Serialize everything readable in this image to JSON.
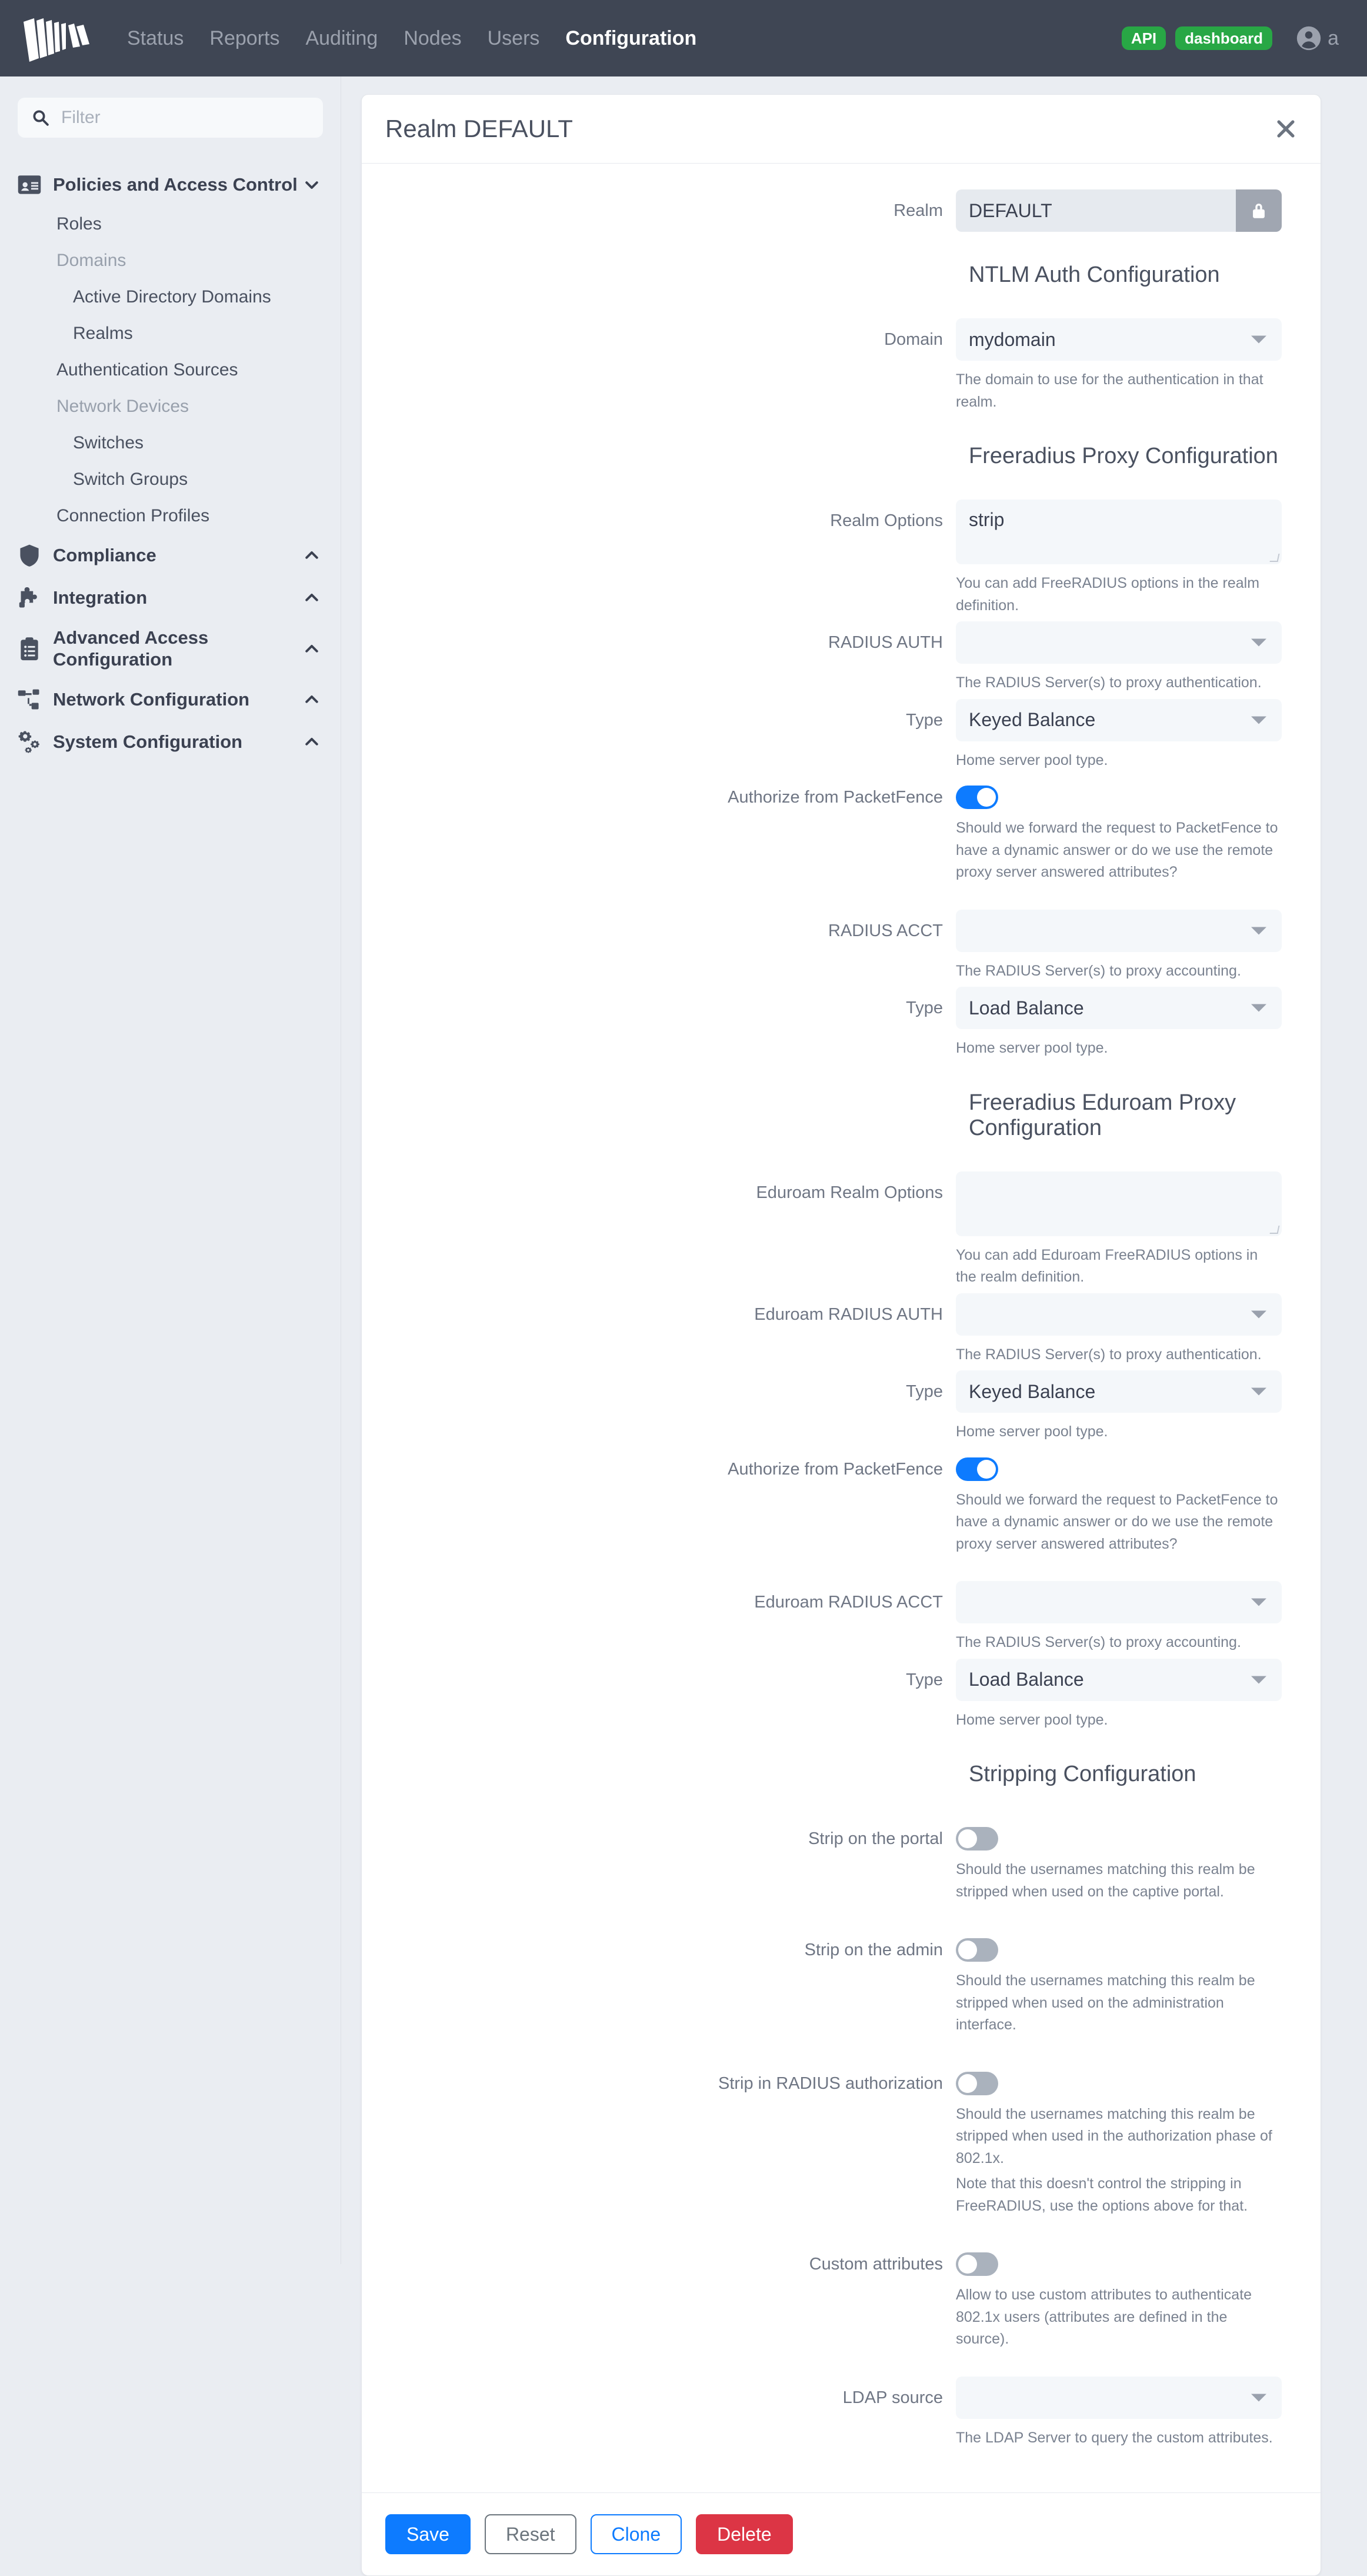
{
  "navbar": {
    "logo_name": "packetfence-logo",
    "links": [
      {
        "label": "Status",
        "active": false
      },
      {
        "label": "Reports",
        "active": false
      },
      {
        "label": "Auditing",
        "active": false
      },
      {
        "label": "Nodes",
        "active": false
      },
      {
        "label": "Users",
        "active": false
      },
      {
        "label": "Configuration",
        "active": true
      }
    ],
    "badges": [
      {
        "label": "API",
        "color": "#28a745"
      },
      {
        "label": "dashboard",
        "color": "#28a745"
      }
    ],
    "user": {
      "name": "a",
      "avatar_icon": "user-circle-icon"
    }
  },
  "sidebar": {
    "filter": {
      "value": "",
      "placeholder": "Filter",
      "icon": "search-icon"
    },
    "groups": [
      {
        "label": "Policies and Access Control",
        "icon": "id-card-icon",
        "chevron": "chevron-down-icon",
        "expanded": true,
        "items": [
          {
            "label": "Roles",
            "type": "item"
          },
          {
            "label": "Domains",
            "type": "subhead"
          },
          {
            "label": "Active Directory Domains",
            "type": "deep"
          },
          {
            "label": "Realms",
            "type": "deep"
          },
          {
            "label": "Authentication Sources",
            "type": "item"
          },
          {
            "label": "Network Devices",
            "type": "subhead"
          },
          {
            "label": "Switches",
            "type": "deep"
          },
          {
            "label": "Switch Groups",
            "type": "deep"
          },
          {
            "label": "Connection Profiles",
            "type": "item"
          }
        ]
      },
      {
        "label": "Compliance",
        "icon": "shield-icon",
        "chevron": "chevron-up-icon",
        "expanded": false,
        "items": []
      },
      {
        "label": "Integration",
        "icon": "puzzle-icon",
        "chevron": "chevron-up-icon",
        "expanded": false,
        "items": []
      },
      {
        "label": "Advanced Access Configuration",
        "icon": "clipboard-list-icon",
        "chevron": "chevron-up-icon",
        "expanded": false,
        "items": []
      },
      {
        "label": "Network Configuration",
        "icon": "sitemap-icon",
        "chevron": "chevron-up-icon",
        "expanded": false,
        "items": []
      },
      {
        "label": "System Configuration",
        "icon": "gears-icon",
        "chevron": "chevron-up-icon",
        "expanded": false,
        "items": []
      }
    ]
  },
  "panel": {
    "title": "Realm DEFAULT",
    "close_icon": "close-icon",
    "realm": {
      "label": "Realm",
      "value": "DEFAULT",
      "locked": true,
      "lock_icon": "lock-icon"
    },
    "sections": [
      {
        "id": "ntlm",
        "title": "NTLM Auth Configuration"
      },
      {
        "id": "freeradius_proxy",
        "title": "Freeradius Proxy Configuration"
      },
      {
        "id": "eduroam_proxy",
        "title": "Freeradius Eduroam Proxy Configuration"
      },
      {
        "id": "stripping",
        "title": "Stripping Configuration"
      }
    ],
    "fields": {
      "domain": {
        "label": "Domain",
        "value": "mydomain",
        "help": "The domain to use for the authentication in that realm."
      },
      "realm_options": {
        "label": "Realm Options",
        "value": "strip",
        "help": "You can add FreeRADIUS options in the realm definition."
      },
      "radius_auth": {
        "label": "RADIUS AUTH",
        "value": "",
        "help": "The RADIUS Server(s) to proxy authentication."
      },
      "radius_auth_type": {
        "label": "Type",
        "value": "Keyed Balance",
        "help": "Home server pool type."
      },
      "authorize_from_packetfence": {
        "label": "Authorize from PacketFence",
        "value": true,
        "help": "Should we forward the request to PacketFence to have a dynamic answer or do we use the remote proxy server answered attributes?"
      },
      "radius_acct": {
        "label": "RADIUS ACCT",
        "value": "",
        "help": "The RADIUS Server(s) to proxy accounting."
      },
      "radius_acct_type": {
        "label": "Type",
        "value": "Load Balance",
        "help": "Home server pool type."
      },
      "eduroam_realm_options": {
        "label": "Eduroam Realm Options",
        "value": "",
        "help": "You can add Eduroam FreeRADIUS options in the realm definition."
      },
      "eduroam_radius_auth": {
        "label": "Eduroam RADIUS AUTH",
        "value": "",
        "help": "The RADIUS Server(s) to proxy authentication."
      },
      "eduroam_radius_auth_type": {
        "label": "Type",
        "value": "Keyed Balance",
        "help": "Home server pool type."
      },
      "eduroam_authorize_from_packetfence": {
        "label": "Authorize from PacketFence",
        "value": true,
        "help": "Should we forward the request to PacketFence to have a dynamic answer or do we use the remote proxy server answered attributes?"
      },
      "eduroam_radius_acct": {
        "label": "Eduroam RADIUS ACCT",
        "value": "",
        "help": "The RADIUS Server(s) to proxy accounting."
      },
      "eduroam_radius_acct_type": {
        "label": "Type",
        "value": "Load Balance",
        "help": "Home server pool type."
      },
      "strip_portal": {
        "label": "Strip on the portal",
        "value": false,
        "help": "Should the usernames matching this realm be stripped when used on the captive portal."
      },
      "strip_admin": {
        "label": "Strip on the admin",
        "value": false,
        "help": "Should the usernames matching this realm be stripped when used on the administration interface."
      },
      "strip_radius_authorization": {
        "label": "Strip in RADIUS authorization",
        "value": false,
        "help": "Should the usernames matching this realm be stripped when used in the authorization phase of 802.1x.",
        "help2": "Note that this doesn't control the stripping in FreeRADIUS, use the options above for that."
      },
      "custom_attributes": {
        "label": "Custom attributes",
        "value": false,
        "help": "Allow to use custom attributes to authenticate 802.1x users (attributes are defined in the source)."
      },
      "ldap_source": {
        "label": "LDAP source",
        "value": "",
        "help": "The LDAP Server to query the custom attributes."
      }
    },
    "footer_buttons": [
      {
        "label": "Save",
        "style": "primary"
      },
      {
        "label": "Reset",
        "style": "outline-secondary"
      },
      {
        "label": "Clone",
        "style": "outline-primary"
      },
      {
        "label": "Delete",
        "style": "danger"
      }
    ]
  },
  "colors": {
    "navbar_bg": "#3f4654",
    "accent": "#0d7bff",
    "success": "#28a745",
    "danger": "#dc3545",
    "page_bg": "#eaedf2"
  }
}
